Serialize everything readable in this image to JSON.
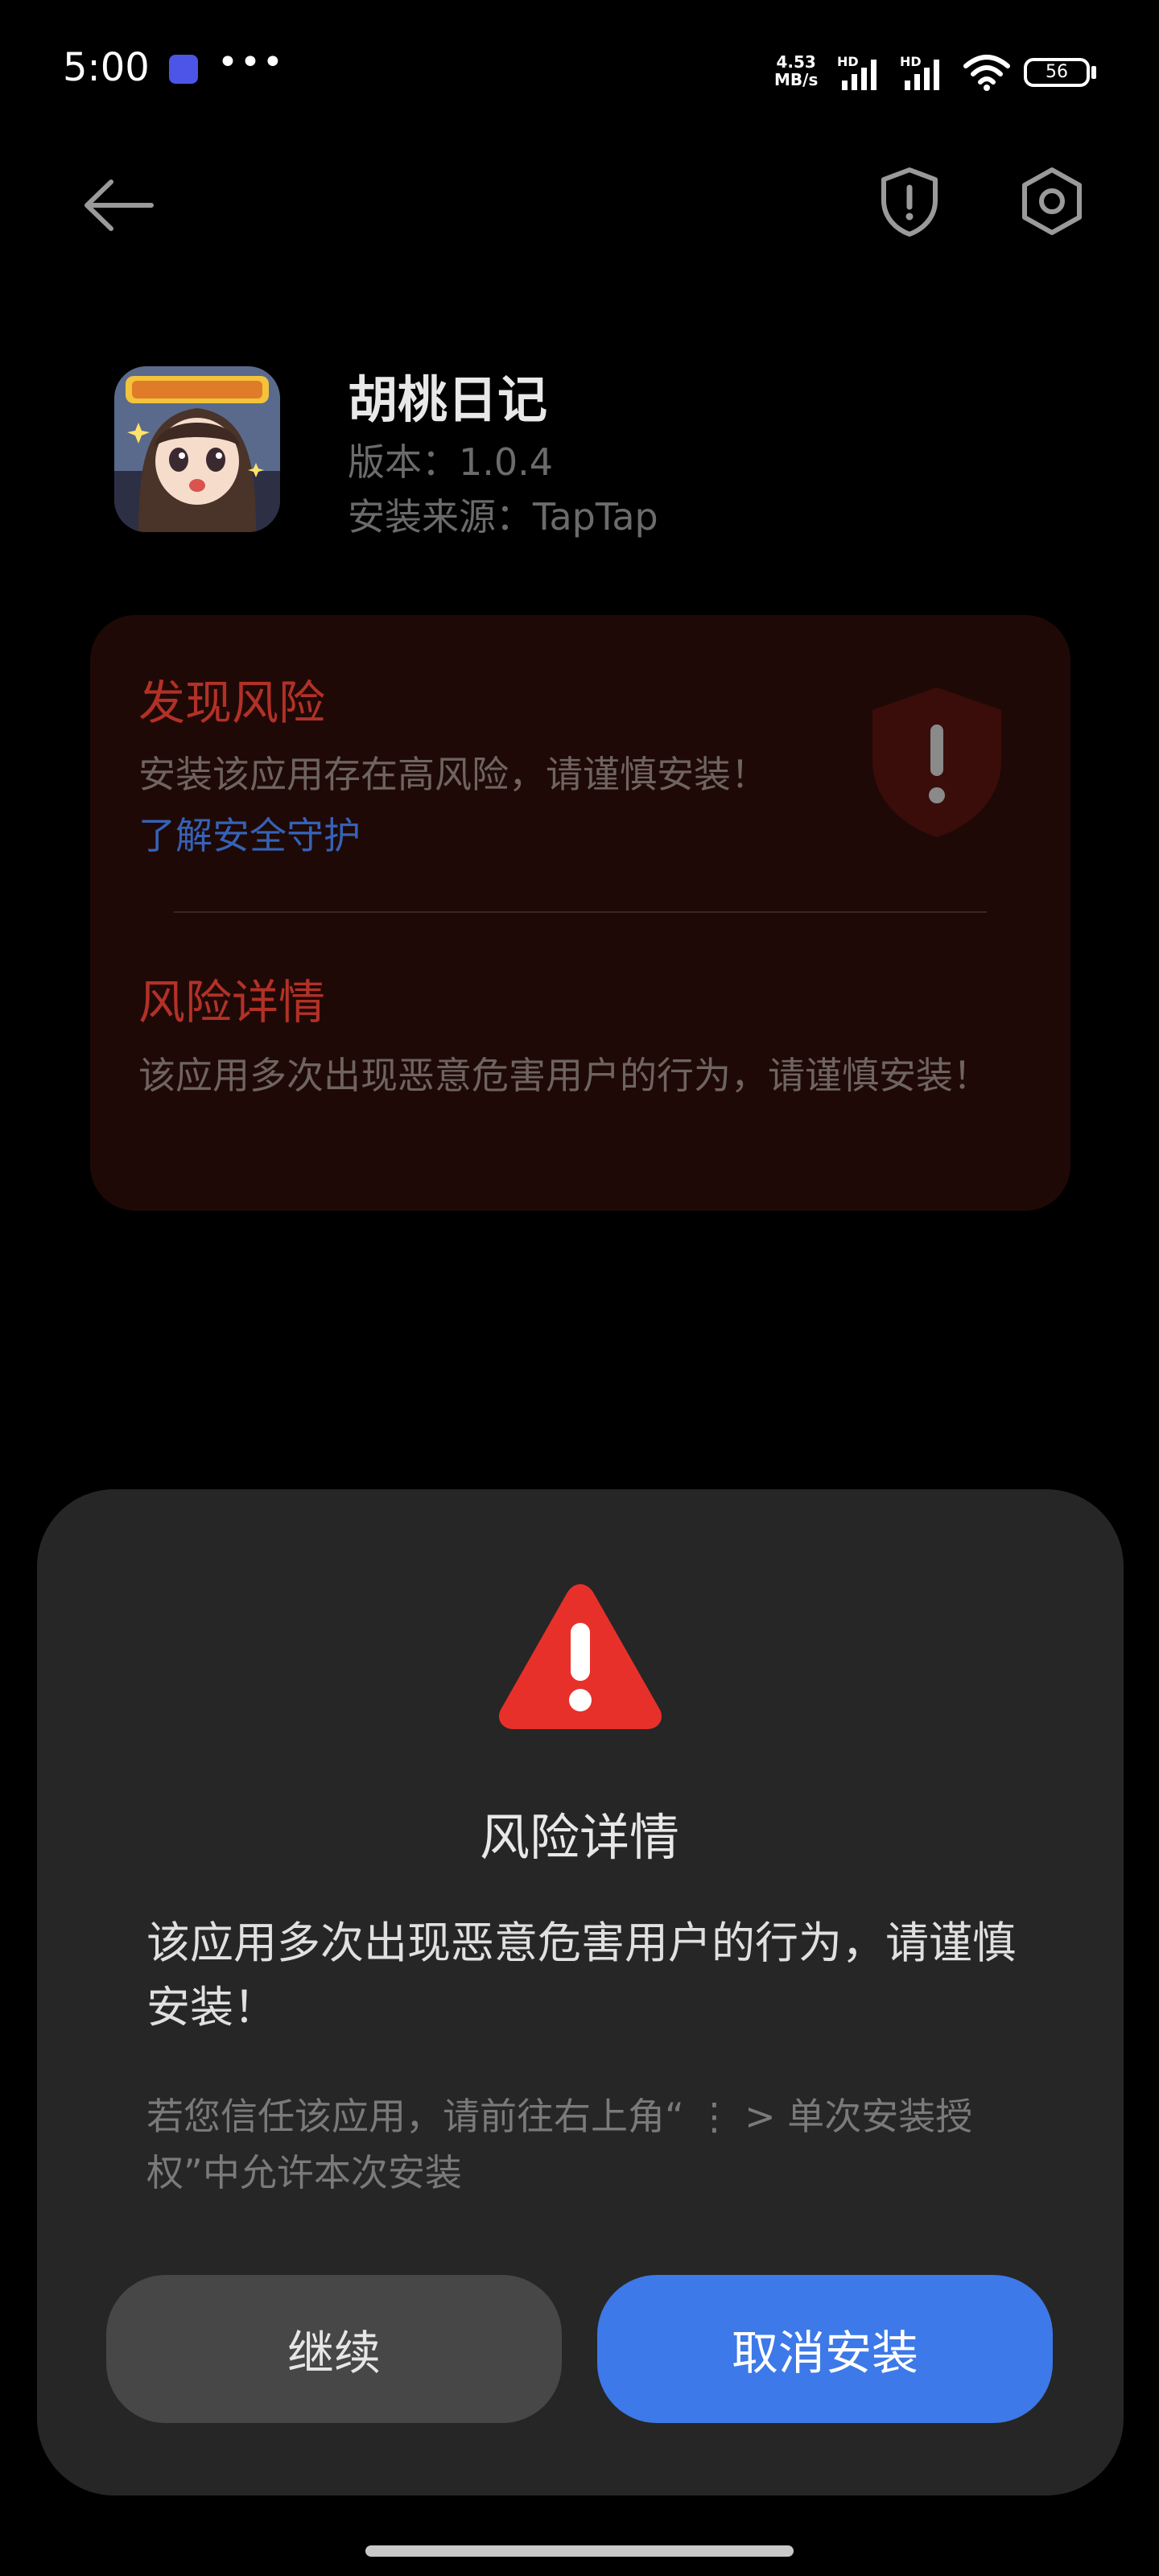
{
  "status_bar": {
    "time": "5:00",
    "more": "•••",
    "speed_value": "4.53",
    "speed_unit": "MB/s",
    "hd1": "HD",
    "hd2": "HD",
    "battery": "56"
  },
  "nav": {
    "back_icon": "arrow-left-icon",
    "shield_icon": "shield-exclamation-icon",
    "settings_icon": "hexagon-gear-icon"
  },
  "app": {
    "name": "胡桃日记",
    "version": "版本：1.0.4",
    "source": "安装来源：TapTap",
    "icon": "app-icon-anime-girl"
  },
  "risk_card": {
    "title": "发现风险",
    "desc": "安装该应用存在高风险，请谨慎安装！",
    "link": "了解安全守护",
    "detail_title": "风险详情",
    "detail_desc": "该应用多次出现恶意危害用户的行为，请谨慎安装！"
  },
  "sheet": {
    "title": "风险详情",
    "main_text": "该应用多次出现恶意危害用户的行为，请谨慎安装！",
    "hint": "若您信任该应用，请前往右上角“ ⋮ > 单次安装授权”中允许本次安装",
    "continue_label": "继续",
    "cancel_label": "取消安装"
  },
  "colors": {
    "accent_blue": "#3d79e8",
    "risk_red": "#b23127",
    "warn_red": "#e8302a"
  }
}
